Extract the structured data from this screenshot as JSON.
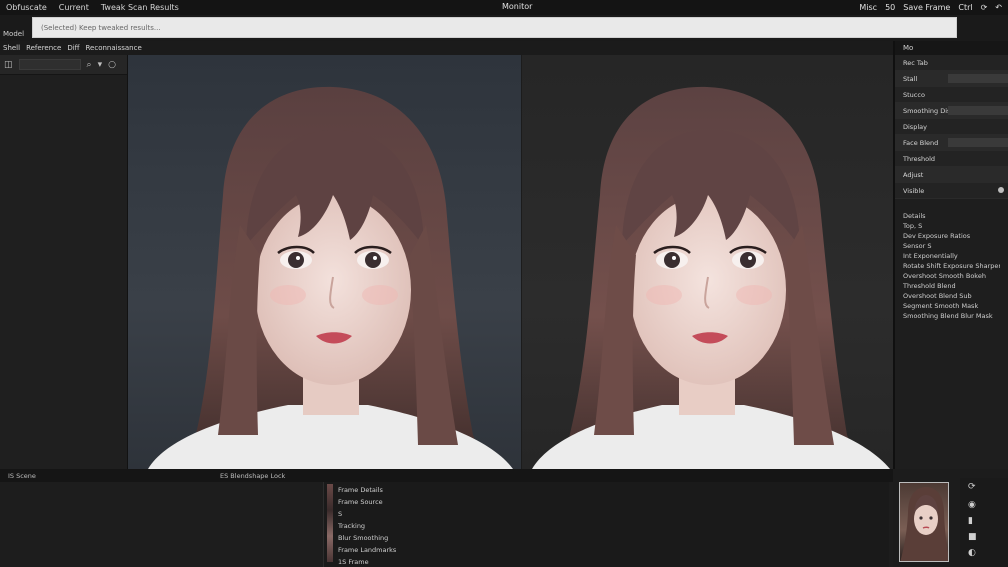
{
  "menubar": {
    "items": [
      "Obfuscate",
      "Current",
      "Tweak Scan Results"
    ],
    "center_title": "Monitor",
    "right_items": [
      "Misc",
      "50",
      "Save Frame",
      "Ctrl"
    ],
    "right_icons": [
      "refresh-icon",
      "undo-icon"
    ]
  },
  "addressbar": {
    "label": "Model",
    "value": "(Selected) Keep tweaked results..."
  },
  "tabbar": {
    "tabs": [
      "Shell",
      "Reference",
      "Diff",
      "Reconnaissance"
    ]
  },
  "leftpanel": {
    "search_icon": "zoom-icon",
    "extra_icon": "circle-icon"
  },
  "rightpanel": {
    "header": "Mo",
    "rows": [
      {
        "label": "Rec Tab"
      },
      {
        "label": "Stall"
      },
      {
        "label": "Stucco"
      },
      {
        "label": "Smoothing Dist"
      },
      {
        "label": "Display"
      },
      {
        "label": "Face Blend"
      },
      {
        "label": "Threshold"
      },
      {
        "label": "Adjust"
      },
      {
        "label": "Visible"
      }
    ],
    "section_lines": [
      "Details",
      "Top, S",
      "Dev Exposure Ratios",
      "Sensor S",
      "Int Exponentially",
      "Rotate Shift Exposure Sharpen",
      "Overshoot Smooth Bokeh",
      "Threshold Blend",
      "Overshoot Blend Sub",
      "Segment Smooth Mask",
      "Smoothing Blend Blur Mask"
    ]
  },
  "bottombar": {
    "left_label": "IS Scene",
    "middle_label": "ES Blendshape Lock"
  },
  "bottompanel": {
    "lines": [
      "Frame Details",
      "Frame Source",
      "S",
      "Tracking",
      "Blur Smoothing",
      "Frame Landmarks",
      "1S Frame"
    ]
  },
  "colors": {
    "background": "#1c1c1c",
    "panel": "#1e1e1e",
    "input_bg": "#e9e9e9",
    "left_canvas_bg": "#333a42",
    "right_canvas_bg": "#282828"
  }
}
